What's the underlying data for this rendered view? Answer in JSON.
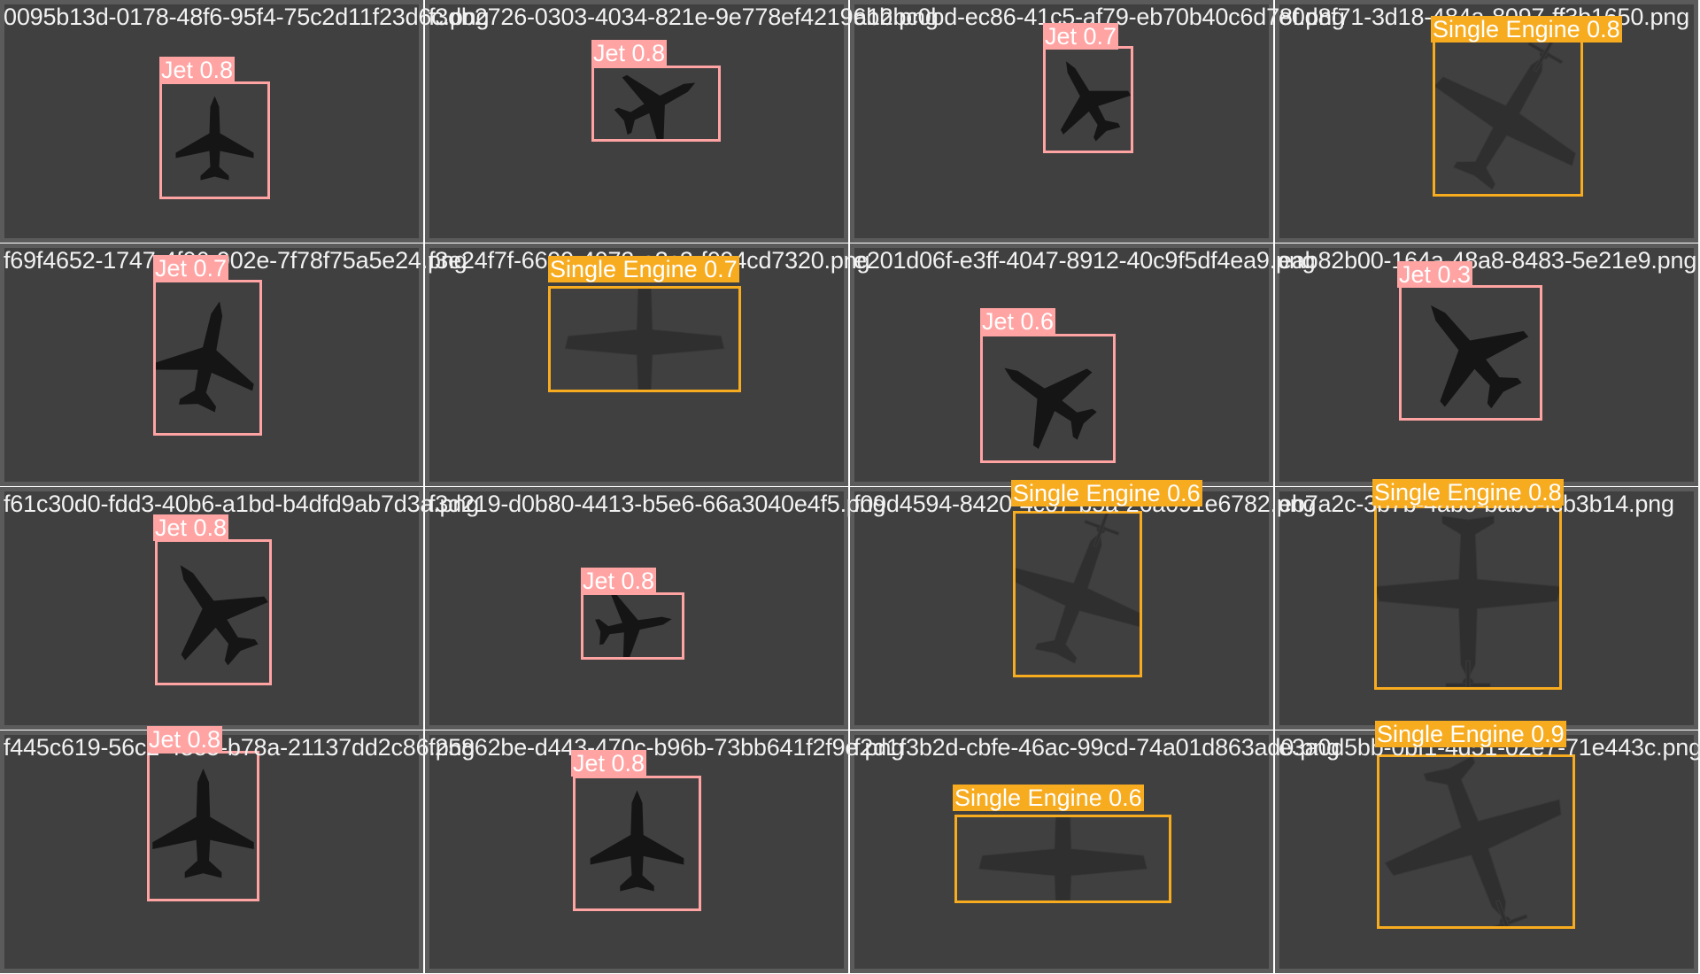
{
  "colors": {
    "jet": "#ffa3a3",
    "single_engine": "#f7ab1f",
    "tile_bg": "#404040",
    "tile_border": "#5b5b5b"
  },
  "tiles": [
    {
      "filename": "0095b13d-0178-48f6-95f4-75c2d11f23d6c.png",
      "label": "Jet 0.8",
      "kind": "jet",
      "icon": "jet-icon"
    },
    {
      "filename": "f3db2726-0303-4034-821e-9e778ef42196bb.png",
      "label": "Jet 0.8",
      "kind": "jet",
      "icon": "jet-icon"
    },
    {
      "filename": "a12bc0bd-ec86-41c5-af79-eb70b40c6d78f.png",
      "label": "Jet 0.7",
      "kind": "jet",
      "icon": "jet-icon"
    },
    {
      "filename": "e0d8f71-3d18-484a-8097-ff3b1650.png",
      "label": "Single Engine 0.8",
      "kind": "single",
      "icon": "propeller-plane-icon"
    },
    {
      "filename": "f69f4652-1747-4f06-902e-7f78f75a5e24.png",
      "label": "Jet 0.7",
      "kind": "jet",
      "icon": "jet-icon"
    },
    {
      "filename": "f3e24f7f-6699-4072-a3c3-f094cd7320.png",
      "label": "Single Engine 0.7",
      "kind": "single",
      "icon": "propeller-plane-icon"
    },
    {
      "filename": "e201d06f-e3ff-4047-8912-40c9f5df4ea9.png",
      "label": "Jet 0.6",
      "kind": "jet",
      "icon": "jet-icon"
    },
    {
      "filename": "eab82b00-164a-48a8-8483-5e21e9.png",
      "label": "Jet 0.3",
      "kind": "jet",
      "icon": "jet-icon"
    },
    {
      "filename": "f61c30d0-fdd3-40b6-a1bd-b4dfd9ab7d3a.png",
      "label": "Jet 0.8",
      "kind": "jet",
      "icon": "jet-icon"
    },
    {
      "filename": "f3d219-d0b80-4413-b5e6-66a3040e4f5.png",
      "label": "Jet 0.8",
      "kind": "jet",
      "icon": "jet-icon"
    },
    {
      "filename": "f09d4594-8420-4c07-b5a-26a091e6782.png",
      "label": "Single Engine 0.6",
      "kind": "single",
      "icon": "propeller-plane-icon"
    },
    {
      "filename": "eb7a2c-3b7b-4ab0-bab0-fcb3b14.png",
      "label": "Single Engine 0.8",
      "kind": "single",
      "icon": "propeller-plane-icon"
    },
    {
      "filename": "f445c619-56c2-48e5-b78a-21137dd2c86.png",
      "label": "Jet 0.8",
      "kind": "jet",
      "icon": "jet-icon"
    },
    {
      "filename": "f25862be-d443-470c-b96b-73bb641f2f9e.png",
      "label": "Jet 0.8",
      "kind": "jet",
      "icon": "jet-icon"
    },
    {
      "filename": "f2d1f3b2d-cbfe-46ac-99cd-74a01d863ad0.png",
      "label": "Single Engine 0.6",
      "kind": "single",
      "icon": "propeller-plane-icon"
    },
    {
      "filename": "e3a0d5bb-0bf1-4d51-02e7-71e443c.png",
      "label": "Single Engine 0.9",
      "kind": "single",
      "icon": "propeller-plane-icon"
    }
  ]
}
